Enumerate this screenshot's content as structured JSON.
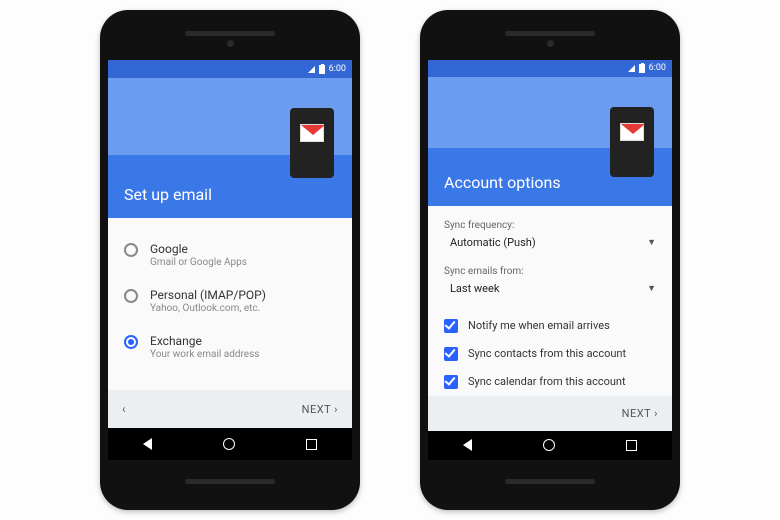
{
  "status": {
    "time": "6:00"
  },
  "phone1": {
    "title": "Set up email",
    "options": [
      {
        "title": "Google",
        "sub": "Gmail or Google Apps",
        "selected": false
      },
      {
        "title": "Personal (IMAP/POP)",
        "sub": "Yahoo, Outlook.com, etc.",
        "selected": false
      },
      {
        "title": "Exchange",
        "sub": "Your work email address",
        "selected": true
      }
    ],
    "back": "‹",
    "next": "NEXT  ›"
  },
  "phone2": {
    "title": "Account options",
    "syncFreqLabel": "Sync frequency:",
    "syncFreqValue": "Automatic (Push)",
    "syncFromLabel": "Sync emails from:",
    "syncFromValue": "Last week",
    "checks": [
      "Notify me when email arrives",
      "Sync contacts from this account",
      "Sync calendar from this account"
    ],
    "next": "NEXT  ›"
  }
}
